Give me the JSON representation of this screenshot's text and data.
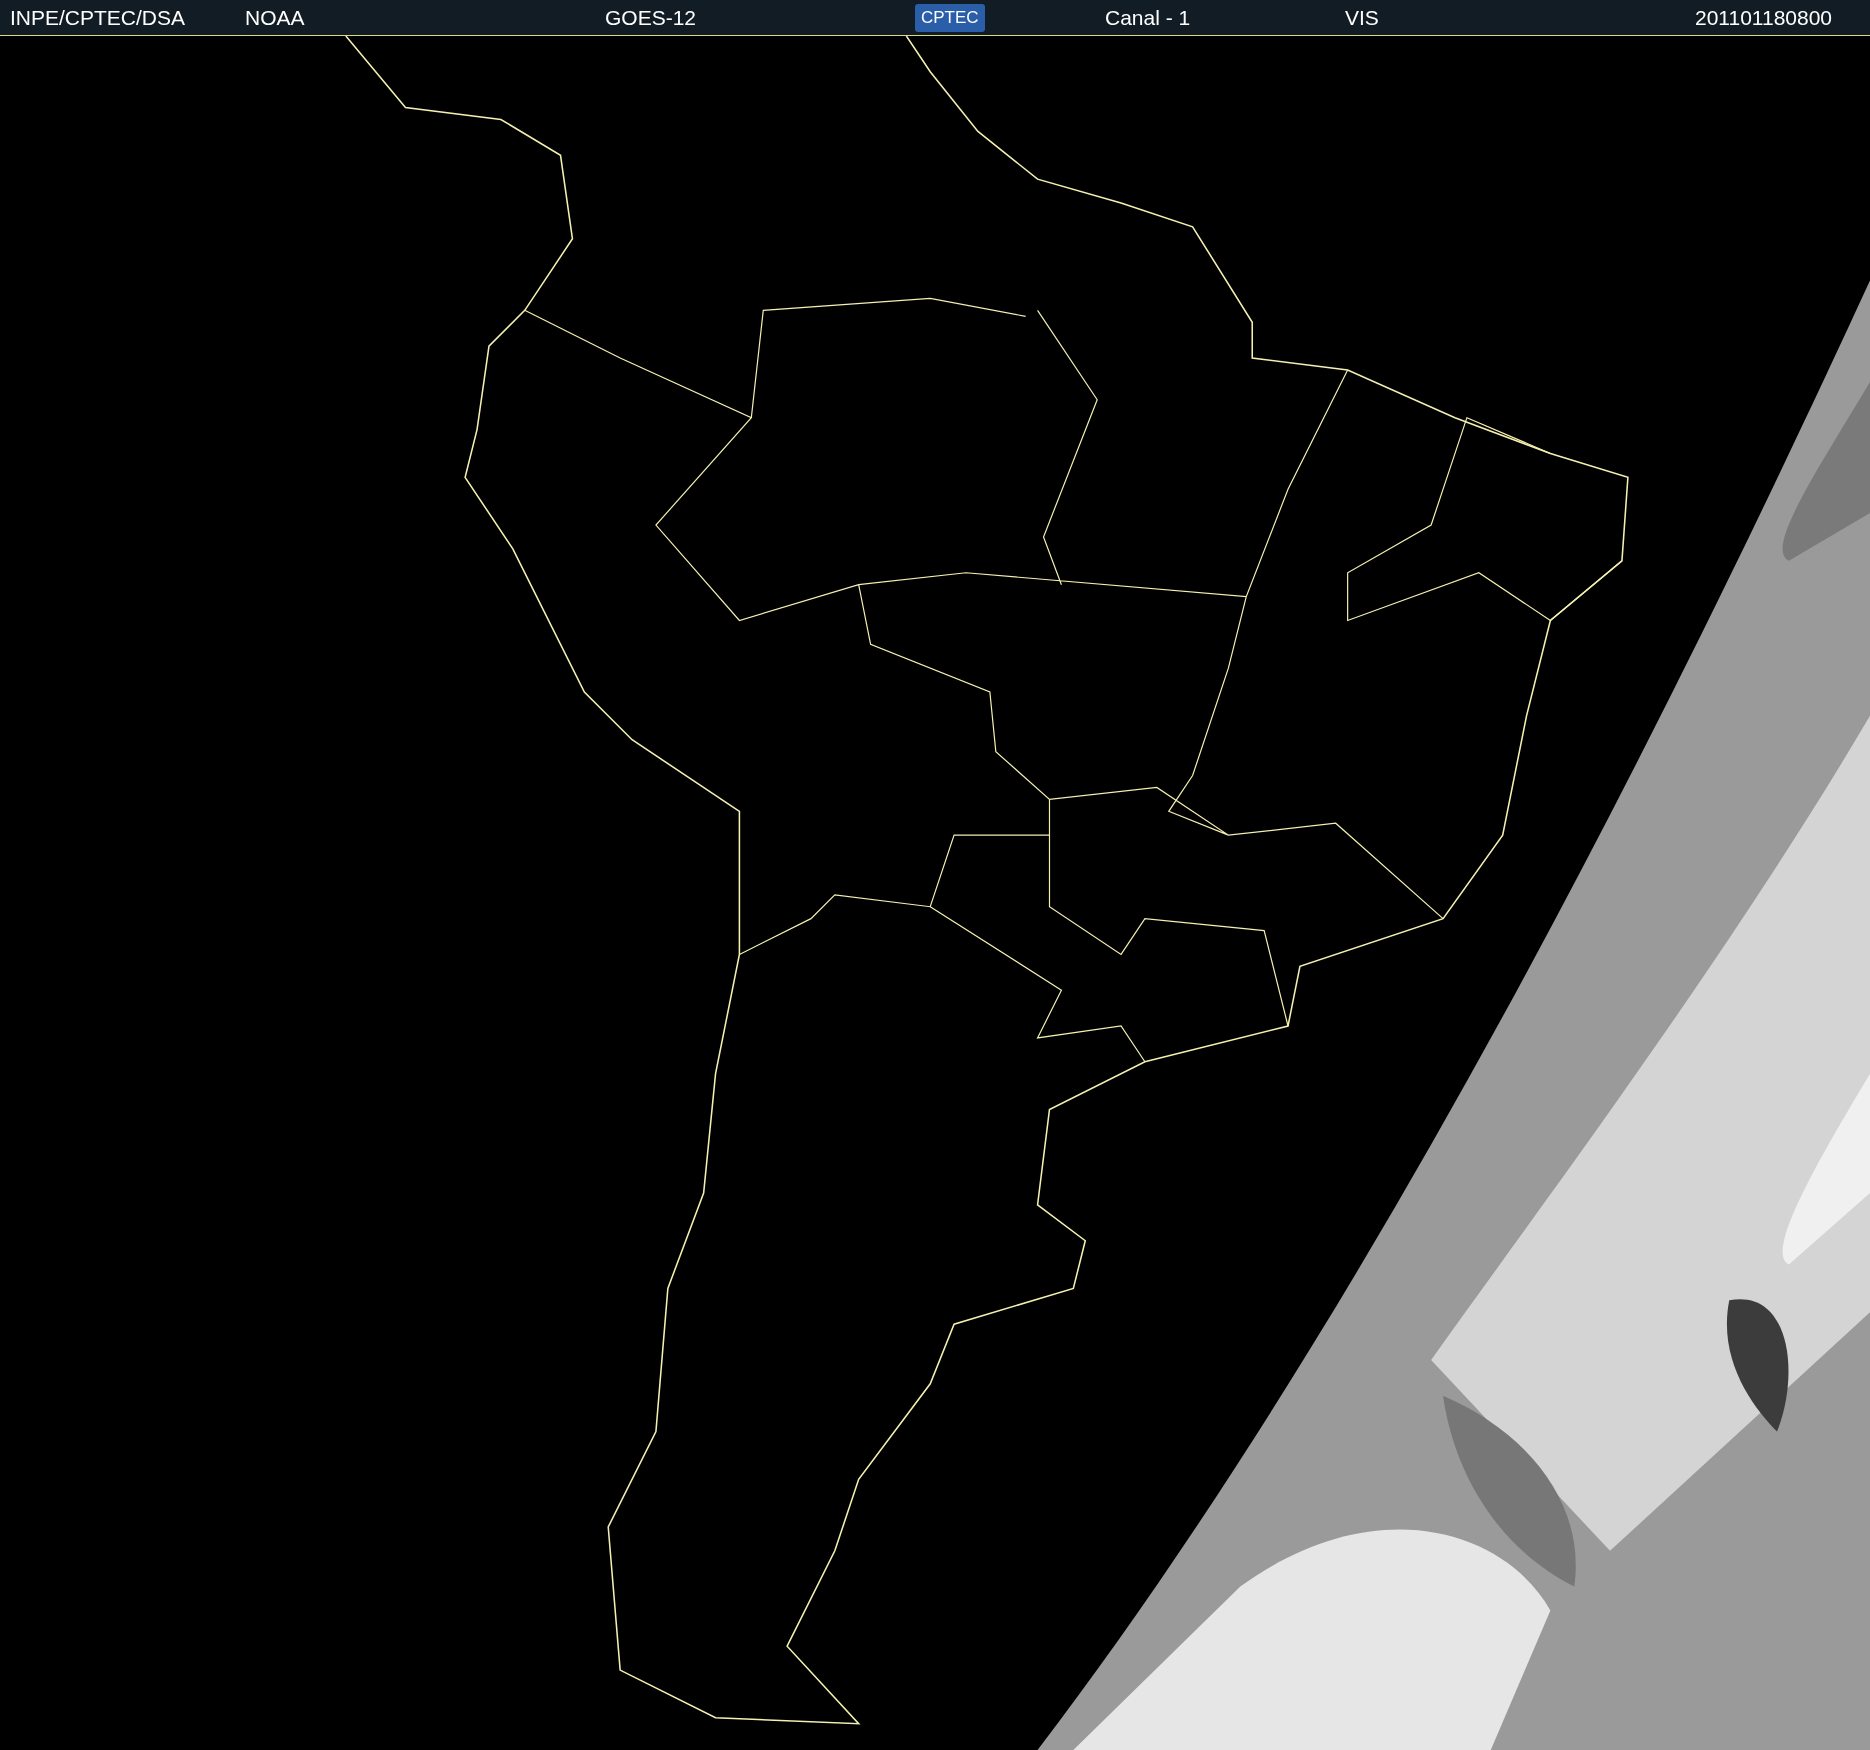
{
  "header": {
    "items": [
      {
        "kind": "text",
        "text": "INPE/CPTEC/DSA"
      },
      {
        "kind": "text",
        "text": "NOAA"
      },
      {
        "kind": "text",
        "text": "GOES-12"
      },
      {
        "kind": "logo",
        "text": "CPTEC"
      },
      {
        "kind": "text",
        "text": "Canal - 1"
      },
      {
        "kind": "text",
        "text": "VIS"
      },
      {
        "kind": "text",
        "text": "201101180800"
      }
    ]
  }
}
